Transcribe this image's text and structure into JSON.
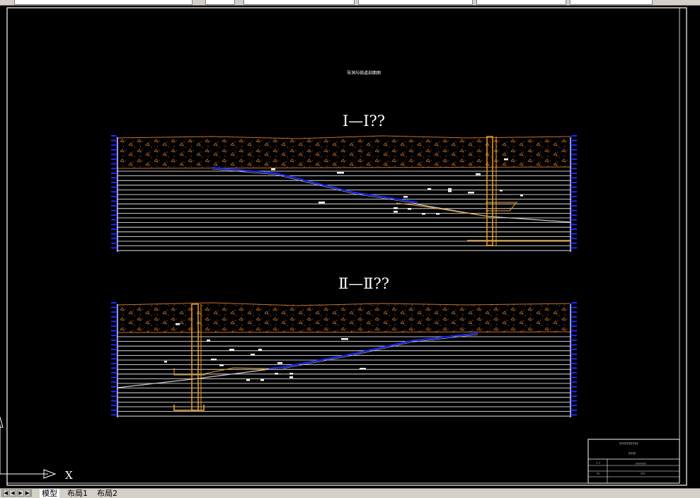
{
  "window": {
    "colors": {
      "background": "#000000",
      "frame": "#ffffff",
      "soil": "#c8702a",
      "line": "#ffffff",
      "tunnel": "#1a2bff",
      "shaft": "#f0a020",
      "axis": "#1a2bff"
    }
  },
  "drawing": {
    "main_title": "导洞与临道剖面图",
    "section1": {
      "title": "Ⅰ—Ⅰ??"
    },
    "section2": {
      "title": "Ⅱ—Ⅱ??"
    }
  },
  "title_block": {
    "row1": "??????????",
    "row2": "????",
    "row3": "???????",
    "col1": "?  ?",
    "col2": "??",
    "col3": "???"
  },
  "ucs": {
    "x_label": "X"
  },
  "layout_tabs": {
    "nav": [
      "|◀",
      "◀",
      "▶",
      "▶|"
    ],
    "tabs": [
      "模型",
      "布局1",
      "布局2"
    ]
  }
}
